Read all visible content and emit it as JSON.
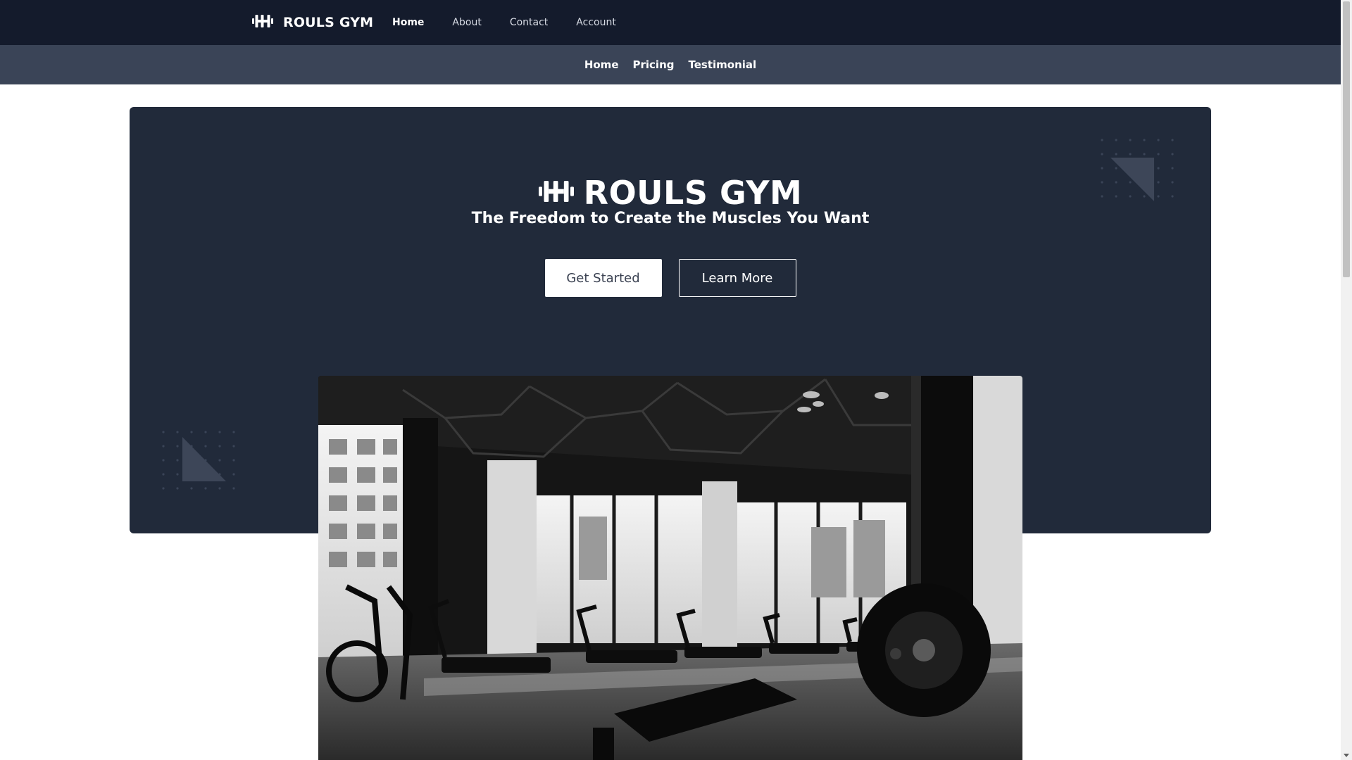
{
  "navbar": {
    "brand": "ROULS GYM",
    "brand_icon": "dumbbell-icon",
    "links": [
      {
        "label": "Home",
        "active": true
      },
      {
        "label": "About",
        "active": false
      },
      {
        "label": "Contact",
        "active": false
      },
      {
        "label": "Account",
        "active": false
      }
    ],
    "background": "#141b2c"
  },
  "subnav": {
    "links": [
      "Home",
      "Pricing",
      "Testimonial"
    ],
    "background": "#3a4457"
  },
  "hero": {
    "title": "ROULS GYM",
    "title_icon": "dumbbell-icon",
    "subtitle": "The Freedom to Create the Muscles You Want",
    "primary_button": "Get Started",
    "secondary_button": "Learn More",
    "background": "#212a3a"
  },
  "image": {
    "description_icon": "gym-interior-photo"
  }
}
